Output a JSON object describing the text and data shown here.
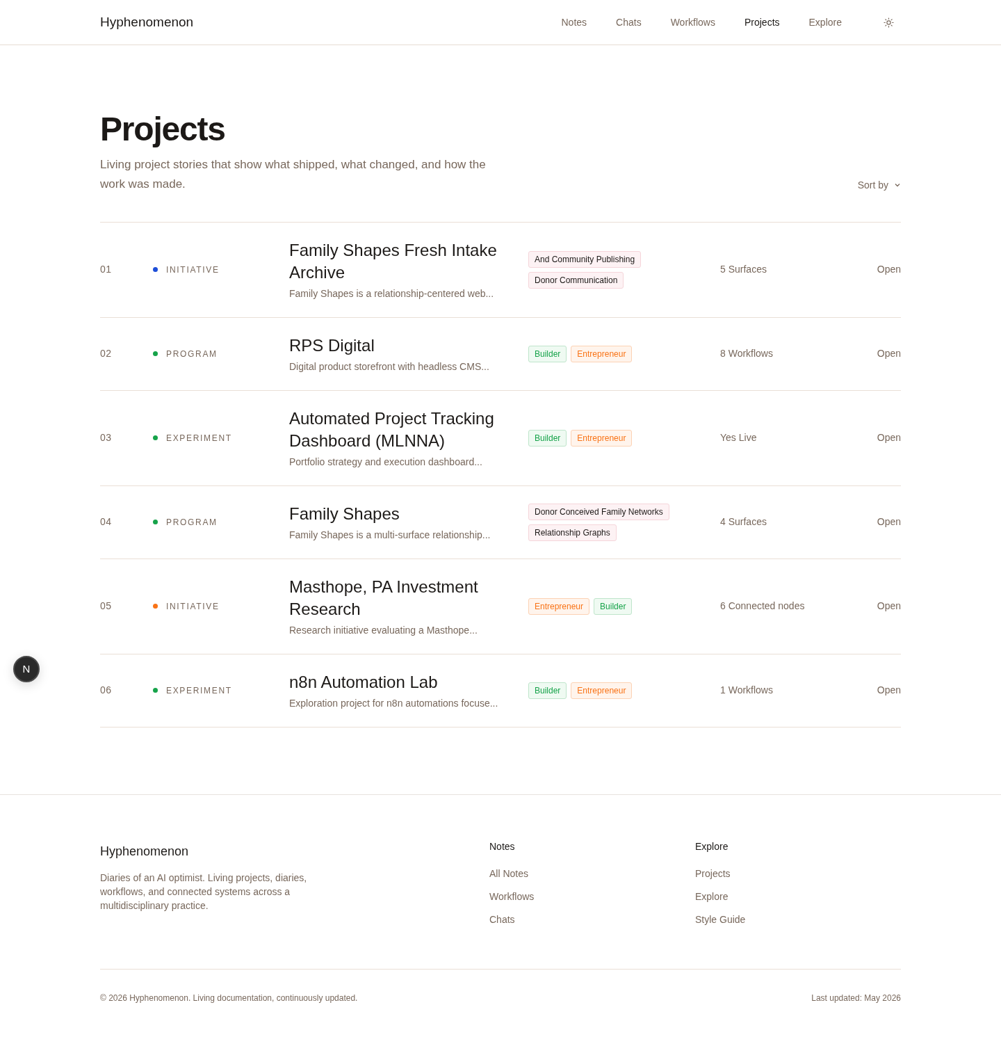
{
  "header": {
    "brand": "Hyphenomenon",
    "nav": [
      {
        "label": "Notes",
        "selected": false
      },
      {
        "label": "Chats",
        "selected": false
      },
      {
        "label": "Workflows",
        "selected": false
      },
      {
        "label": "Projects",
        "selected": true
      },
      {
        "label": "Explore",
        "selected": false
      }
    ]
  },
  "page": {
    "title": "Projects",
    "subtitle": "Living project stories that show what shipped, what changed, and how the work was made.",
    "sort": "Sort by"
  },
  "projects": [
    {
      "number": "01",
      "type": "INITIATIVE",
      "color": "#1d4ed8",
      "title": "Family Shapes Fresh Intake Archive",
      "summary": "Family Shapes is a relationship-centered web...",
      "tags": [
        {
          "label": "And Community Publishing",
          "kind": "topic"
        },
        {
          "label": "Donor Communication",
          "kind": "topic"
        }
      ],
      "meta": "5 Surfaces",
      "action": "Open"
    },
    {
      "number": "02",
      "type": "PROGRAM",
      "color": "#16a34a",
      "title": "RPS Digital",
      "summary": "Digital product storefront with headless CMS...",
      "tags": [
        {
          "label": "Builder",
          "kind": "builder"
        },
        {
          "label": "Entrepreneur",
          "kind": "entrepreneur"
        }
      ],
      "meta": "8 Workflows",
      "action": "Open"
    },
    {
      "number": "03",
      "type": "EXPERIMENT",
      "color": "#16a34a",
      "title": "Automated Project Tracking Dashboard (MLNNA)",
      "summary": "Portfolio strategy and execution dashboard...",
      "tags": [
        {
          "label": "Builder",
          "kind": "builder"
        },
        {
          "label": "Entrepreneur",
          "kind": "entrepreneur"
        }
      ],
      "meta": "Yes Live",
      "action": "Open"
    },
    {
      "number": "04",
      "type": "PROGRAM",
      "color": "#16a34a",
      "title": "Family Shapes",
      "summary": "Family Shapes is a multi-surface relationship...",
      "tags": [
        {
          "label": "Donor Conceived Family Networks",
          "kind": "topic"
        },
        {
          "label": "Relationship Graphs",
          "kind": "topic"
        }
      ],
      "meta": "4 Surfaces",
      "action": "Open"
    },
    {
      "number": "05",
      "type": "INITIATIVE",
      "color": "#f97316",
      "title": "Masthope, PA Investment Research",
      "summary": "Research initiative evaluating a Masthope...",
      "tags": [
        {
          "label": "Entrepreneur",
          "kind": "entrepreneur"
        },
        {
          "label": "Builder",
          "kind": "builder"
        }
      ],
      "meta": "6 Connected nodes",
      "action": "Open"
    },
    {
      "number": "06",
      "type": "EXPERIMENT",
      "color": "#16a34a",
      "title": "n8n Automation Lab",
      "summary": "Exploration project for n8n automations focuse...",
      "tags": [
        {
          "label": "Builder",
          "kind": "builder"
        },
        {
          "label": "Entrepreneur",
          "kind": "entrepreneur"
        }
      ],
      "meta": "1 Workflows",
      "action": "Open"
    }
  ],
  "dev_badge": "N",
  "footer": {
    "brand": "Hyphenomenon",
    "description": "Diaries of an AI optimist. Living projects, diaries, workflows, and connected systems across a multidisciplinary practice.",
    "columns": [
      {
        "heading": "Notes",
        "links": [
          "All Notes",
          "Workflows",
          "Chats"
        ]
      },
      {
        "heading": "Explore",
        "links": [
          "Projects",
          "Explore",
          "Style Guide"
        ]
      }
    ],
    "copyright": "© 2026 Hyphenomenon. Living documentation, continuously updated.",
    "updated": "Last updated: May 2026"
  }
}
